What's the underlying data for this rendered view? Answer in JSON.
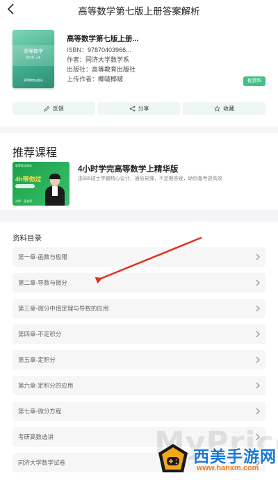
{
  "header": {
    "title": "高等数学第七版上册答案解析",
    "back_icon": "chevron-left-icon"
  },
  "book": {
    "cover": {
      "title": "高等数学",
      "subtitle": "第七版 上册",
      "publisher": "高等教育出版社"
    },
    "name": "高等数学第七版上册...",
    "isbn_label": "ISBN：",
    "isbn": "97870403966...",
    "author_label": "作者：",
    "author": "同济大学数学系",
    "publisher_label": "出版社：",
    "publisher": "高等教育出版社",
    "uploader_label": "上传作者：",
    "uploader": "椰啵椰啵",
    "tag": "有资料",
    "actions": [
      {
        "label": "反馈",
        "icon": "edit-icon"
      },
      {
        "label": "分享",
        "icon": "share-icon"
      },
      {
        "label": "收藏",
        "icon": "star-icon"
      }
    ]
  },
  "recommend": {
    "heading": "推荐课程",
    "course": {
      "title": "4小时学完高等数学上精华版",
      "subtitle": "由985硕士学霸精心设计，通俗易懂，不定期答疑，助你备考更高效",
      "thumb_top": "高等数学期末",
      "thumb_main": "4h带你过",
      "thumb_name": "讲师：孟老师"
    }
  },
  "catalog": {
    "heading": "资料目录",
    "items": [
      "第一章-函数与极限",
      "第二章-导数与微分",
      "第三章-微分中值定理与导数的应用",
      "第四章-不定积分",
      "第五章-定积分",
      "第六章-定积分的应用",
      "第七章-微分方程",
      "考研高数选讲",
      "同济大学数学试卷"
    ]
  },
  "annotation": {
    "arrow_color": "#e0301e"
  },
  "watermark": {
    "text": "MyPrice",
    "site_name": "西美手游网",
    "url": "www.hanxm.com"
  },
  "colors": {
    "accent": "#3fc283",
    "action_bg": "#eef7f2",
    "item_bg": "#f6f6f7"
  }
}
